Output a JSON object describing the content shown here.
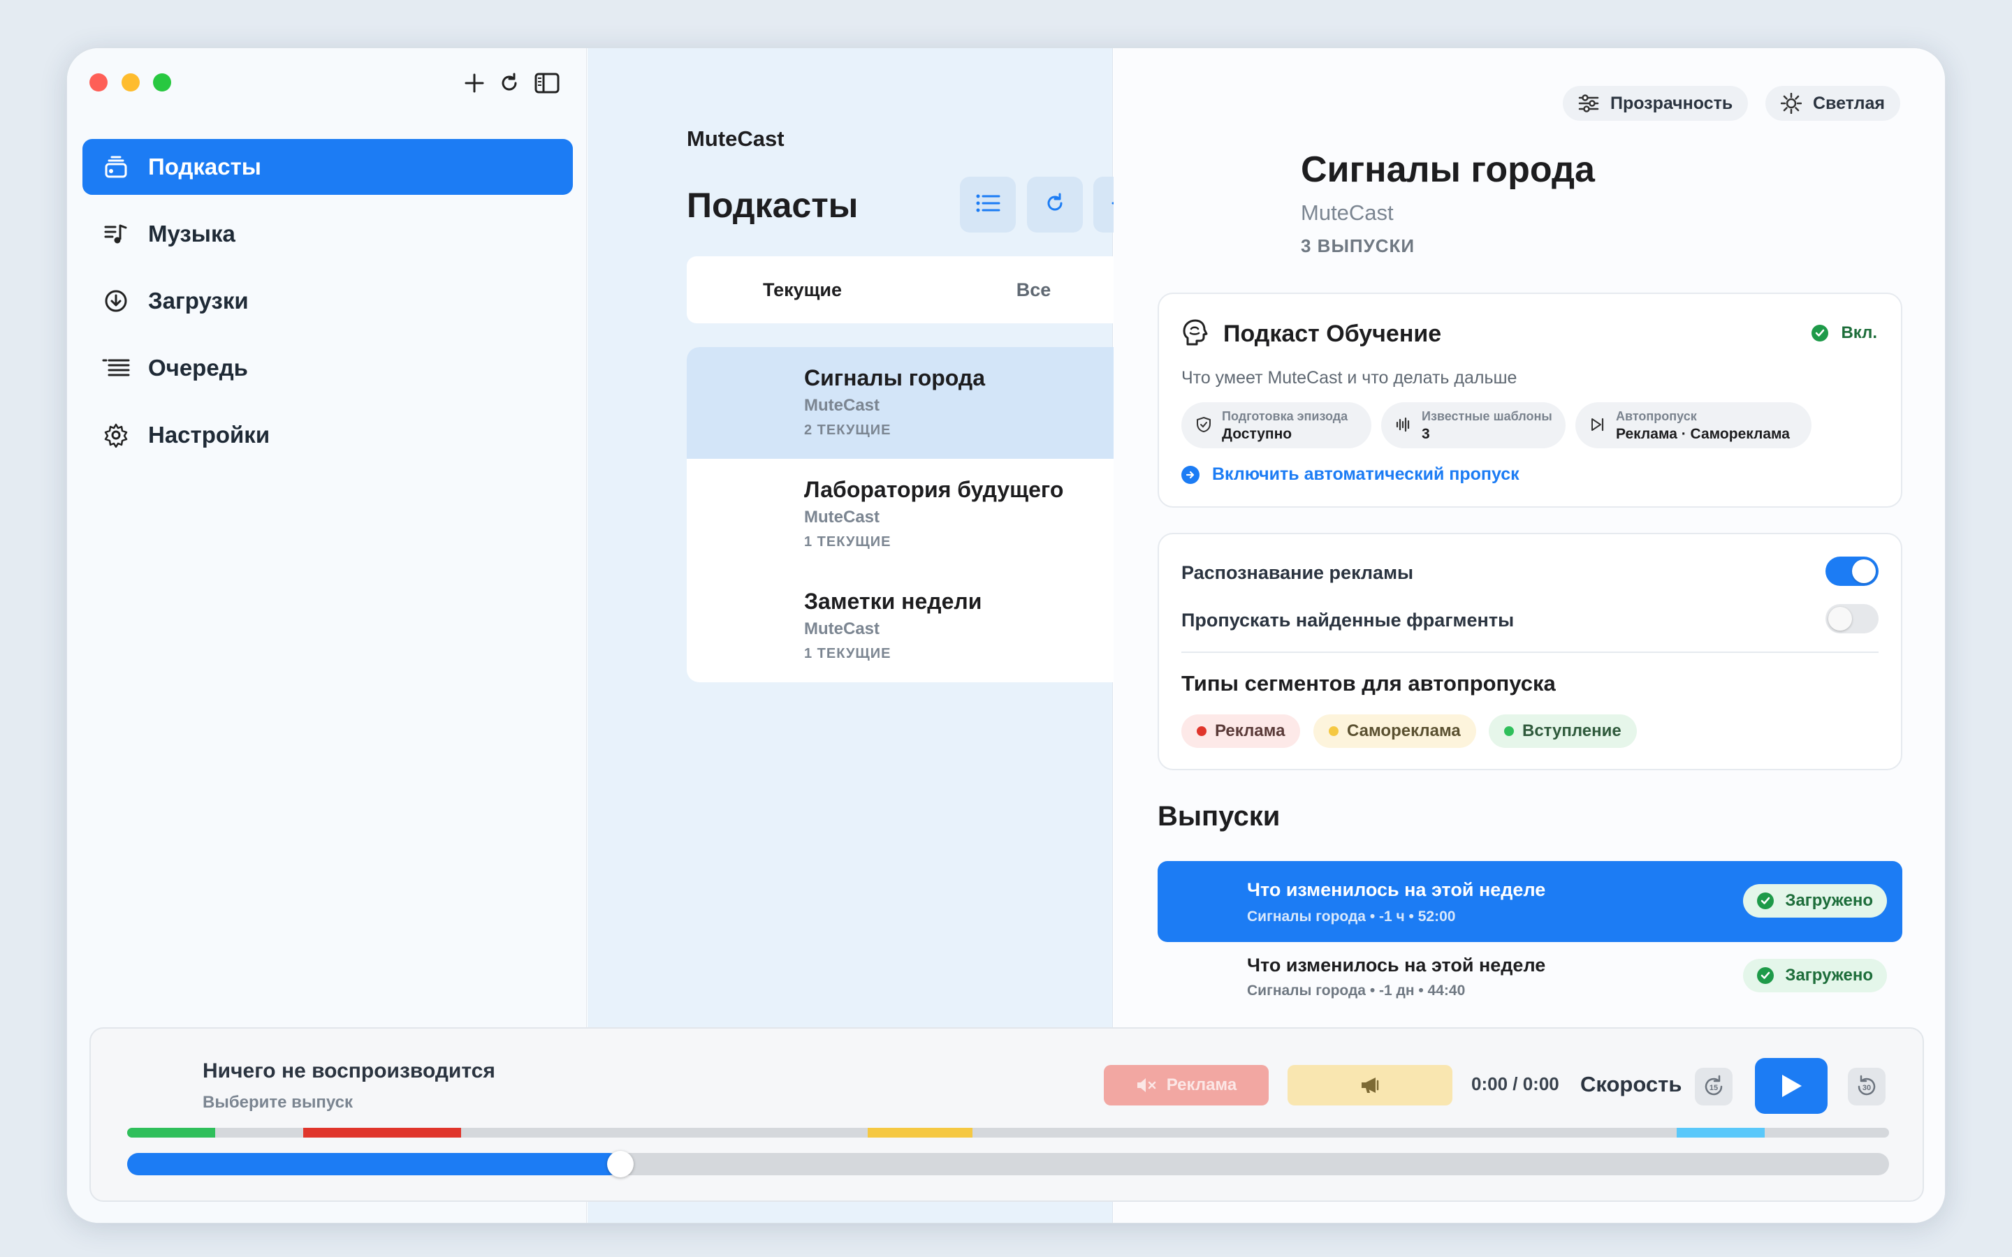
{
  "sidebar": {
    "items": [
      {
        "label": "Подкасты",
        "icon": "podcasts-icon",
        "active": true
      },
      {
        "label": "Музыка",
        "icon": "music-icon"
      },
      {
        "label": "Загрузки",
        "icon": "download-icon"
      },
      {
        "label": "Очередь",
        "icon": "queue-icon"
      },
      {
        "label": "Настройки",
        "icon": "gear-icon"
      }
    ]
  },
  "middle": {
    "app_name": "MuteCast",
    "title": "Подкасты",
    "segments": [
      "Текущие",
      "Все"
    ],
    "podcasts": [
      {
        "title": "Сигналы города",
        "author": "MuteCast",
        "count": "2 ТЕКУЩИЕ",
        "selected": true
      },
      {
        "title": "Лаборатория будущего",
        "author": "MuteCast",
        "count": "1 ТЕКУЩИЕ"
      },
      {
        "title": "Заметки недели",
        "author": "MuteCast",
        "count": "1 ТЕКУЩИЕ"
      }
    ]
  },
  "detail": {
    "transparency_label": "Прозрачность",
    "theme_label": "Светлая",
    "title": "Сигналы города",
    "author": "MuteCast",
    "episode_count": "3 ВЫПУСКИ",
    "learning": {
      "title": "Подкаст Обучение",
      "status": "Вкл.",
      "subtitle": "Что умеет MuteCast и что делать дальше",
      "chips": [
        {
          "label": "Подготовка эпизода",
          "value": "Доступно"
        },
        {
          "label": "Известные шаблоны",
          "value": "3"
        },
        {
          "label": "Автопропуск",
          "value": "Реклама · Самореклама"
        }
      ],
      "link": "Включить автоматический пропуск"
    },
    "settings": {
      "ad_detection": "Распознавание рекламы",
      "ad_detection_on": true,
      "skip_found": "Пропускать найденные фрагменты",
      "skip_found_on": false,
      "segment_types_title": "Типы сегментов для автопропуска",
      "tags": [
        {
          "label": "Реклама",
          "color": "#e0352b",
          "bg": "#fde9e8"
        },
        {
          "label": "Самореклама",
          "color": "#f5c842",
          "bg": "#fdf4dc"
        },
        {
          "label": "Вступление",
          "color": "#2fbf5b",
          "bg": "#e6f6ea"
        }
      ]
    },
    "episodes_title": "Выпуски",
    "episodes": [
      {
        "title": "Что изменилось на этой неделе",
        "meta": "Сигналы города • -1 ч • 52:00",
        "badge": "Загружено",
        "selected": true
      },
      {
        "title": "Что изменилось на этой неделе",
        "meta": "Сигналы города • -1 дн • 44:40",
        "badge": "Загружено"
      }
    ]
  },
  "player": {
    "title": "Ничего не воспроизводится",
    "subtitle": "Выберите выпуск",
    "ad_button": "Реклама",
    "time": "0:00 / 0:00",
    "speed": "Скорость",
    "skip_back": "15",
    "skip_forward": "30",
    "progress": 0.28
  },
  "colors": {
    "accent": "#1c7cf4",
    "ad": "#e0352b",
    "self_promo": "#f5c842",
    "intro": "#2fbf5b",
    "outro": "#5ac8fa"
  }
}
